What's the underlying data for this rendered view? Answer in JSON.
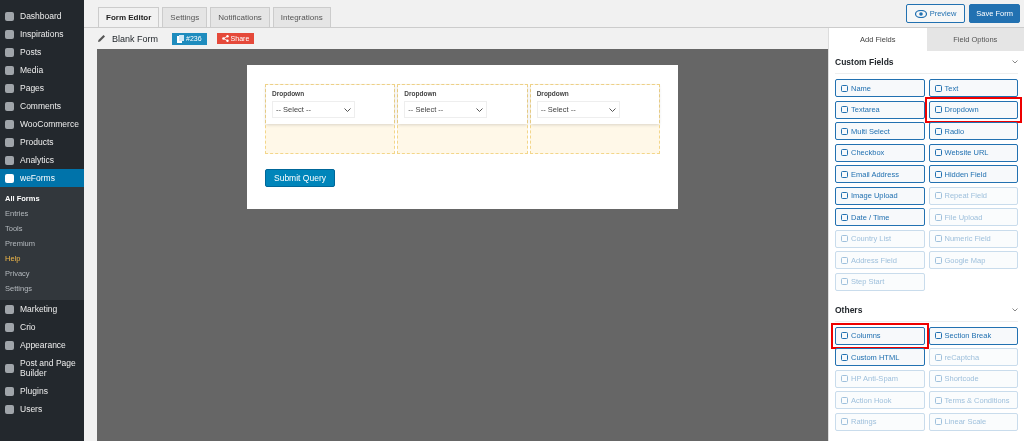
{
  "sidebar": {
    "items": [
      {
        "label": "Dashboard",
        "selected": false
      },
      {
        "label": "Inspirations",
        "selected": false
      },
      {
        "label": "Posts",
        "selected": false
      },
      {
        "label": "Media",
        "selected": false
      },
      {
        "label": "Pages",
        "selected": false
      },
      {
        "label": "Comments",
        "selected": false
      },
      {
        "label": "WooCommerce",
        "selected": false
      },
      {
        "label": "Products",
        "selected": false
      },
      {
        "label": "Analytics",
        "selected": false
      },
      {
        "label": "weForms",
        "selected": true,
        "submenu": [
          {
            "label": "All Forms",
            "selected": true,
            "hovered": false
          },
          {
            "label": "Entries",
            "selected": false,
            "hovered": false
          },
          {
            "label": "Tools",
            "selected": false,
            "hovered": false
          },
          {
            "label": "Premium",
            "selected": false,
            "hovered": false
          },
          {
            "label": "Help",
            "selected": false,
            "hovered": true
          },
          {
            "label": "Privacy",
            "selected": false,
            "hovered": false
          },
          {
            "label": "Settings",
            "selected": false,
            "hovered": false
          }
        ]
      },
      {
        "label": "Marketing",
        "selected": false
      },
      {
        "label": "Crio",
        "selected": false
      },
      {
        "label": "Appearance",
        "selected": false
      },
      {
        "label": "Post and Page Builder",
        "selected": false
      },
      {
        "label": "Plugins",
        "selected": false
      },
      {
        "label": "Users",
        "selected": false
      }
    ]
  },
  "tabs": [
    {
      "label": "Form Editor",
      "selected": true
    },
    {
      "label": "Settings",
      "selected": false
    },
    {
      "label": "Notifications",
      "selected": false
    },
    {
      "label": "Integrations",
      "selected": false
    }
  ],
  "actions": {
    "preview": "Preview",
    "save": "Save Form"
  },
  "form_header": {
    "title": "Blank Form",
    "id_badge": "#236",
    "share": "Share"
  },
  "form": {
    "columns": [
      {
        "label": "Dropdown",
        "placeholder": "-- Select --"
      },
      {
        "label": "Dropdown",
        "placeholder": "-- Select --"
      },
      {
        "label": "Dropdown",
        "placeholder": "-- Select --"
      }
    ],
    "submit": "Submit Query"
  },
  "panel": {
    "tabs": [
      {
        "label": "Add Fields",
        "selected": true
      },
      {
        "label": "Field Options",
        "selected": false
      }
    ],
    "sections": [
      {
        "title": "Custom Fields",
        "fields": [
          {
            "label": "Name",
            "disabled": false,
            "highlighted": false
          },
          {
            "label": "Text",
            "disabled": false,
            "highlighted": false
          },
          {
            "label": "Textarea",
            "disabled": false,
            "highlighted": false
          },
          {
            "label": "Dropdown",
            "disabled": false,
            "highlighted": true
          },
          {
            "label": "Multi Select",
            "disabled": false,
            "highlighted": false
          },
          {
            "label": "Radio",
            "disabled": false,
            "highlighted": false
          },
          {
            "label": "Checkbox",
            "disabled": false,
            "highlighted": false
          },
          {
            "label": "Website URL",
            "disabled": false,
            "highlighted": false
          },
          {
            "label": "Email Address",
            "disabled": false,
            "highlighted": false
          },
          {
            "label": "Hidden Field",
            "disabled": false,
            "highlighted": false
          },
          {
            "label": "Image Upload",
            "disabled": false,
            "highlighted": false
          },
          {
            "label": "Repeat Field",
            "disabled": true,
            "highlighted": false
          },
          {
            "label": "Date / Time",
            "disabled": false,
            "highlighted": false
          },
          {
            "label": "File Upload",
            "disabled": true,
            "highlighted": false
          },
          {
            "label": "Country List",
            "disabled": true,
            "highlighted": false
          },
          {
            "label": "Numeric Field",
            "disabled": true,
            "highlighted": false
          },
          {
            "label": "Address Field",
            "disabled": true,
            "highlighted": false
          },
          {
            "label": "Google Map",
            "disabled": true,
            "highlighted": false
          },
          {
            "label": "Step Start",
            "disabled": true,
            "highlighted": false
          }
        ]
      },
      {
        "title": "Others",
        "fields": [
          {
            "label": "Columns",
            "disabled": false,
            "highlighted": true
          },
          {
            "label": "Section Break",
            "disabled": false,
            "highlighted": false
          },
          {
            "label": "Custom HTML",
            "disabled": false,
            "highlighted": false
          },
          {
            "label": "reCaptcha",
            "disabled": true,
            "highlighted": false
          },
          {
            "label": "HP Anti-Spam",
            "disabled": true,
            "highlighted": false
          },
          {
            "label": "Shortcode",
            "disabled": true,
            "highlighted": false
          },
          {
            "label": "Action Hook",
            "disabled": true,
            "highlighted": false
          },
          {
            "label": "Terms & Conditions",
            "disabled": true,
            "highlighted": false
          },
          {
            "label": "Ratings",
            "disabled": true,
            "highlighted": false
          },
          {
            "label": "Linear Scale",
            "disabled": true,
            "highlighted": false
          }
        ]
      }
    ]
  }
}
